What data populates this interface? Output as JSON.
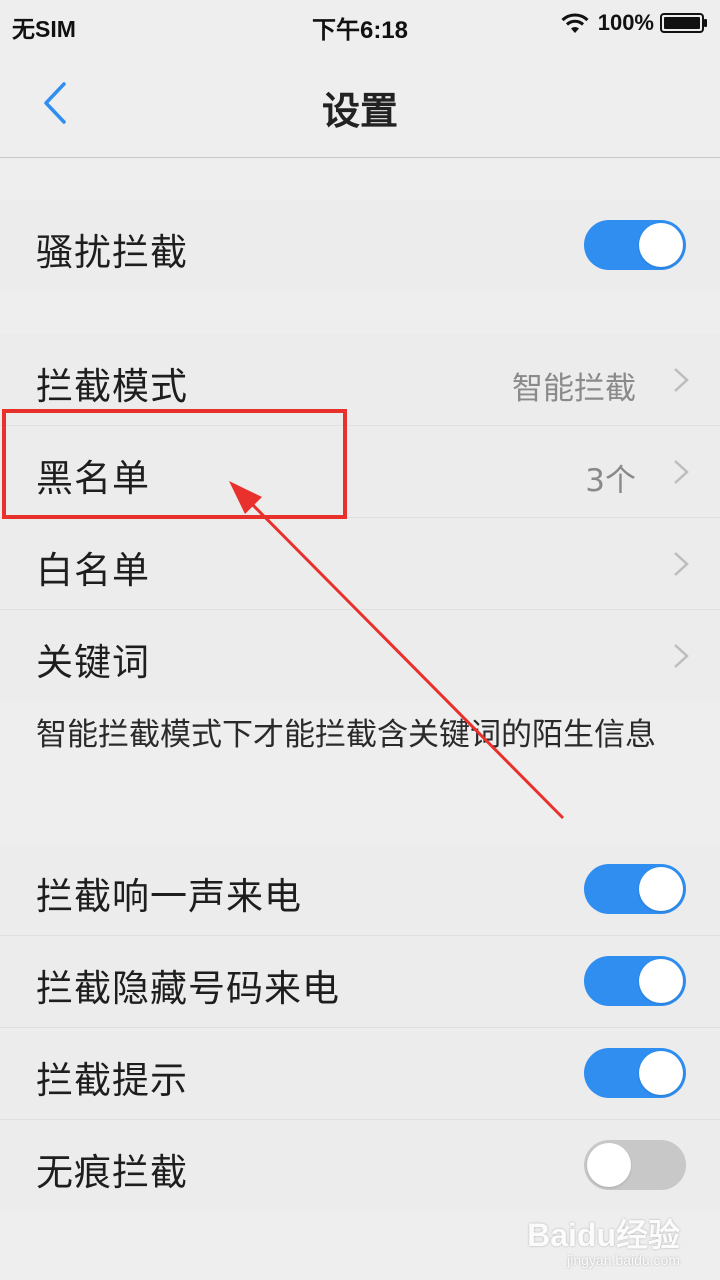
{
  "status_bar": {
    "carrier": "无SIM",
    "time": "下午6:18",
    "battery": "100%"
  },
  "header": {
    "title": "设置",
    "back_icon": "chevron-left-icon"
  },
  "sections": {
    "harassment": {
      "label": "骚扰拦截",
      "toggle_on": true
    },
    "modes": {
      "items": [
        {
          "label": "拦截模式",
          "value": "智能拦截"
        },
        {
          "label": "黑名单",
          "value": "3个"
        },
        {
          "label": "白名单",
          "value": ""
        },
        {
          "label": "关键词",
          "value": ""
        }
      ],
      "hint": "智能拦截模式下才能拦截含关键词的陌生信息"
    },
    "toggles": {
      "items": [
        {
          "label": "拦截响一声来电",
          "toggle_on": true
        },
        {
          "label": "拦截隐藏号码来电",
          "toggle_on": true
        },
        {
          "label": "拦截提示",
          "toggle_on": true
        },
        {
          "label": "无痕拦截",
          "toggle_on": false
        }
      ]
    }
  },
  "watermark": {
    "logo": "Baidu经验",
    "url": "jingyan.baidu.com"
  },
  "colors": {
    "accent": "#2f8ef0",
    "annotation": "#e8302c",
    "background": "#eeeeee"
  }
}
